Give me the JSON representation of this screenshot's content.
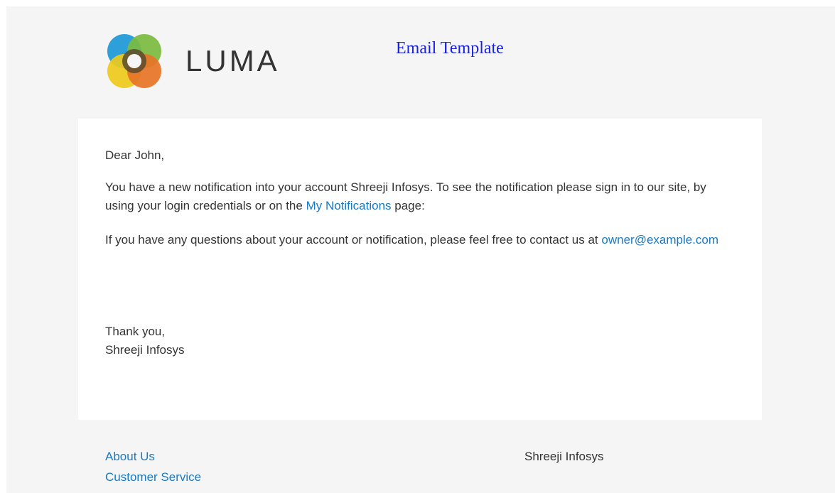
{
  "header": {
    "logo_text": "LUMA",
    "title": "Email Template"
  },
  "body": {
    "greeting": "Dear John,",
    "para1_before_link": "You have a new notification into your account Shreeji Infosys. To see the notification please sign in to our site, by using your login credentials or on the ",
    "para1_link": "My Notifications",
    "para1_after_link": " page:",
    "para2_text": "If you have any questions about your account or notification, please feel free to contact us at ",
    "para2_email": "owner@example.com",
    "closing_line1": "Thank you,",
    "closing_line2": "Shreeji Infosys"
  },
  "footer": {
    "links": [
      "About Us",
      "Customer Service"
    ],
    "company": "Shreeji Infosys"
  },
  "colors": {
    "brand_title": "#1a22e0",
    "link": "#1979c3",
    "text": "#333333",
    "background": "#f5f5f5"
  }
}
